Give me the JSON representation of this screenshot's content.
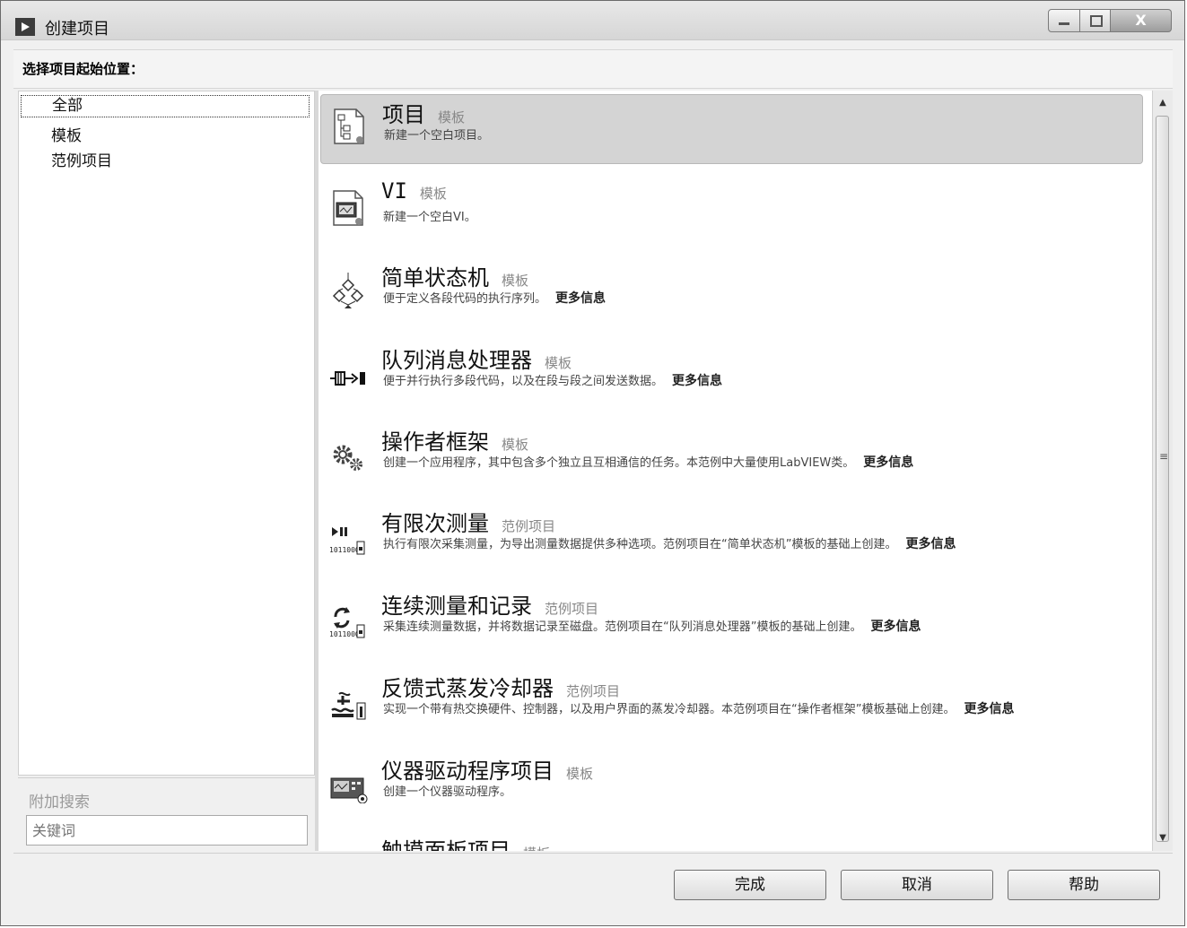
{
  "window": {
    "title": "创建项目",
    "prompt": "选择项目起始位置："
  },
  "sidebar": {
    "categories": [
      {
        "label": "全部",
        "selected": true
      },
      {
        "label": "模板"
      },
      {
        "label": "范例项目"
      }
    ],
    "search": {
      "label": "附加搜索",
      "placeholder": "关键词"
    }
  },
  "items": [
    {
      "name": "项目",
      "tag": "模板",
      "desc": "新建一个空白项目。",
      "more": "",
      "icon": "project-file-icon",
      "selected": true
    },
    {
      "name": "VI",
      "tag": "模板",
      "desc": "新建一个空白VI。",
      "more": "",
      "icon": "vi-file-icon"
    },
    {
      "name": "简单状态机",
      "tag": "模板",
      "desc": "便于定义各段代码的执行序列。",
      "more": "更多信息",
      "icon": "state-machine-icon"
    },
    {
      "name": "队列消息处理器",
      "tag": "模板",
      "desc": "便于并行执行多段代码，以及在段与段之间发送数据。",
      "more": "更多信息",
      "icon": "queue-icon"
    },
    {
      "name": "操作者框架",
      "tag": "模板",
      "desc": "创建一个应用程序，其中包含多个独立且互相通信的任务。本范例中大量使用LabVIEW类。",
      "more": "更多信息",
      "icon": "gears-icon"
    },
    {
      "name": "有限次测量",
      "tag": "范例项目",
      "desc": "执行有限次采集测量，为导出测量数据提供多种选项。范例项目在“简单状态机”模板的基础上创建。",
      "more": "更多信息",
      "icon": "finite-measure-icon"
    },
    {
      "name": "连续测量和记录",
      "tag": "范例项目",
      "desc": "采集连续测量数据，并将数据记录至磁盘。范例项目在“队列消息处理器”模板的基础上创建。",
      "more": "更多信息",
      "icon": "continuous-measure-icon"
    },
    {
      "name": "反馈式蒸发冷却器",
      "tag": "范例项目",
      "desc": "实现一个带有热交换硬件、控制器，以及用户界面的蒸发冷却器。本范例项目在“操作者框架”模板基础上创建。",
      "more": "更多信息",
      "icon": "cooler-icon"
    },
    {
      "name": "仪器驱动程序项目",
      "tag": "模板",
      "desc": "创建一个仪器驱动程序。",
      "more": "",
      "icon": "instrument-icon"
    },
    {
      "name": "触摸面板项目",
      "tag": "模板",
      "desc": "",
      "more": "",
      "icon": "touch-panel-icon"
    }
  ],
  "buttons": {
    "finish": "完成",
    "cancel": "取消",
    "help": "帮助"
  },
  "scrollbar": {
    "grip": "≡",
    "up": "▲",
    "down": "▼"
  }
}
